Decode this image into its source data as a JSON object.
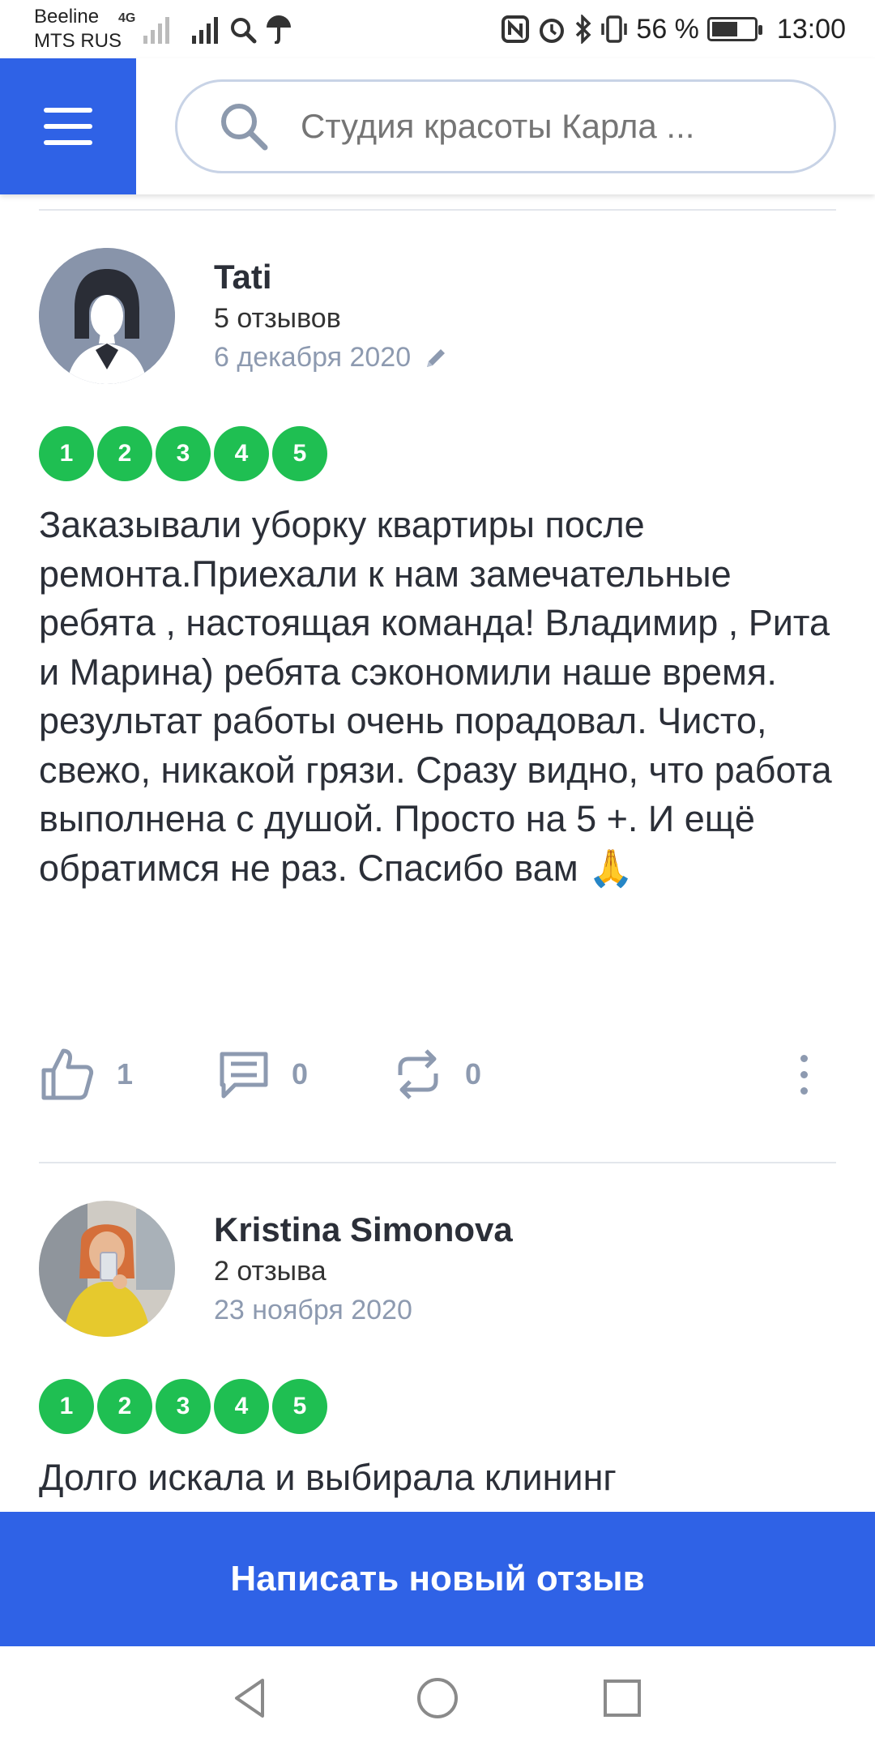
{
  "status_bar": {
    "carrier_line1": "Beeline",
    "carrier_line2": "MTS RUS",
    "network_type": "4G",
    "battery_percent": "56 %",
    "battery_level": 0.56,
    "time": "13:00"
  },
  "header": {
    "menu_icon": "hamburger-icon",
    "search_placeholder": "Студия красоты Карла ...",
    "search_icon": "search-icon"
  },
  "reviews": [
    {
      "author": "Tati",
      "review_count": "5 отзывов",
      "date": "6 декабря 2020",
      "edited_icon": "pencil-icon",
      "rating": [
        "1",
        "2",
        "3",
        "4",
        "5"
      ],
      "text": "Заказывали уборку квартиры после ремонта.Приехали к нам замечательные ребята , настоящая команда! Владимир , Рита и Марина) ребята сэкономили наше время. результат работы очень порадовал. Чисто, свежо, никакой грязи. Сразу видно, что работа выполнена с душой. Просто на 5 +. И ещё обратимся не раз. Спасибо вам 🙏",
      "likes": "1",
      "comments": "0",
      "reposts": "0"
    },
    {
      "author": "Kristina Simonova",
      "review_count": "2 отзыва",
      "date": "23 ноября 2020",
      "rating": [
        "1",
        "2",
        "3",
        "4",
        "5"
      ],
      "text": "Долго искала и выбирала клининг"
    }
  ],
  "cta": {
    "label": "Написать новый отзыв"
  },
  "colors": {
    "accent": "#2f62e6",
    "rating_green": "#1fbf52",
    "muted": "#8d9ab0"
  }
}
